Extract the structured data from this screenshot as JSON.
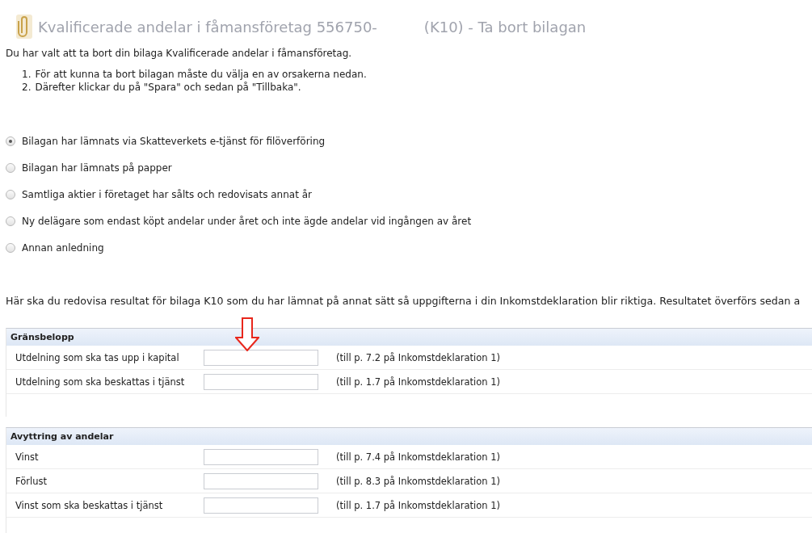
{
  "title": {
    "main": "Kvalificerade andelar i fåmansföretag 556750-",
    "suffix": "(K10) - Ta bort bilagan"
  },
  "intro": "Du har valt att ta bort din bilaga Kvalificerade andelar i fåmansföretag.",
  "steps": [
    "För att kunna ta bort bilagan måste du välja en av orsakerna nedan.",
    "Därefter klickar du på \"Spara\" och sedan på \"Tillbaka\"."
  ],
  "markers": [
    "1.",
    "2."
  ],
  "reasons": [
    {
      "label": "Bilagan har lämnats via Skatteverkets e-tjänst för filöverföring",
      "selected": true
    },
    {
      "label": "Bilagan har lämnats på papper",
      "selected": false
    },
    {
      "label": "Samtliga aktier i företaget har sålts och redovisats annat år",
      "selected": false
    },
    {
      "label": "Ny delägare som endast köpt andelar under året och inte ägde andelar vid ingången av året",
      "selected": false
    },
    {
      "label": "Annan anledning",
      "selected": false
    }
  ],
  "note": "Här ska du redovisa resultat för bilaga K10 som du har lämnat på annat sätt så uppgifterna i din Inkomstdeklaration blir riktiga. Resultatet överförs sedan a",
  "sections": [
    {
      "heading": "Gränsbelopp",
      "annotated": true,
      "rows": [
        {
          "label": "Utdelning som ska tas upp i kapital",
          "hint": "(till p. 7.2 på Inkomstdeklaration 1)"
        },
        {
          "label": "Utdelning som ska beskattas i tjänst",
          "hint": "(till p. 1.7 på Inkomstdeklaration 1)"
        }
      ]
    },
    {
      "heading": "Avyttring av andelar",
      "annotated": false,
      "rows": [
        {
          "label": "Vinst",
          "hint": "(till p. 7.4 på Inkomstdeklaration 1)"
        },
        {
          "label": "Förlust",
          "hint": "(till p. 8.3 på Inkomstdeklaration 1)"
        },
        {
          "label": "Vinst som ska beskattas i tjänst",
          "hint": "(till p. 1.7 på Inkomstdeklaration 1)"
        }
      ]
    }
  ]
}
